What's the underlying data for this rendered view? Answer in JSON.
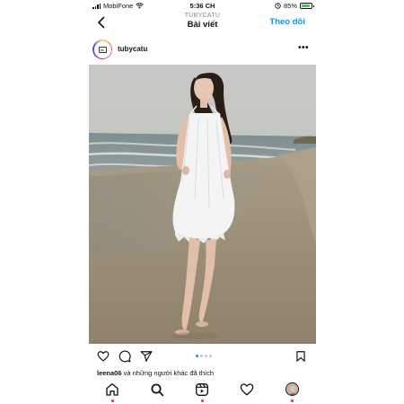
{
  "status_bar": {
    "carrier": "MobiFone",
    "time": "5:36 CH",
    "battery": "85%",
    "battery_level": 0.85,
    "icons": [
      "signal-icon",
      "wifi-icon",
      "location-icon",
      "battery-icon"
    ]
  },
  "header": {
    "username": "TUBYCATU",
    "title": "Bài viết",
    "follow_label": "Theo dõi",
    "icons": [
      "back-chevron-icon"
    ]
  },
  "post": {
    "username": "tubycatu",
    "more_label": "•••",
    "image_icon": "beach-photo",
    "carousel": {
      "count": 4,
      "active": 0
    },
    "actions": [
      "heart-icon",
      "comment-icon",
      "share-icon",
      "bookmark-icon"
    ],
    "likes": {
      "user": "leena06",
      "text": "và những người khác đã thích"
    }
  },
  "bottom_nav": {
    "items": [
      "home-icon",
      "search-icon",
      "reels-icon",
      "activity-icon",
      "profile-avatar"
    ]
  },
  "colors": {
    "accent": "#0095f6",
    "notification": "#ff3040",
    "battery": "#34c759"
  }
}
